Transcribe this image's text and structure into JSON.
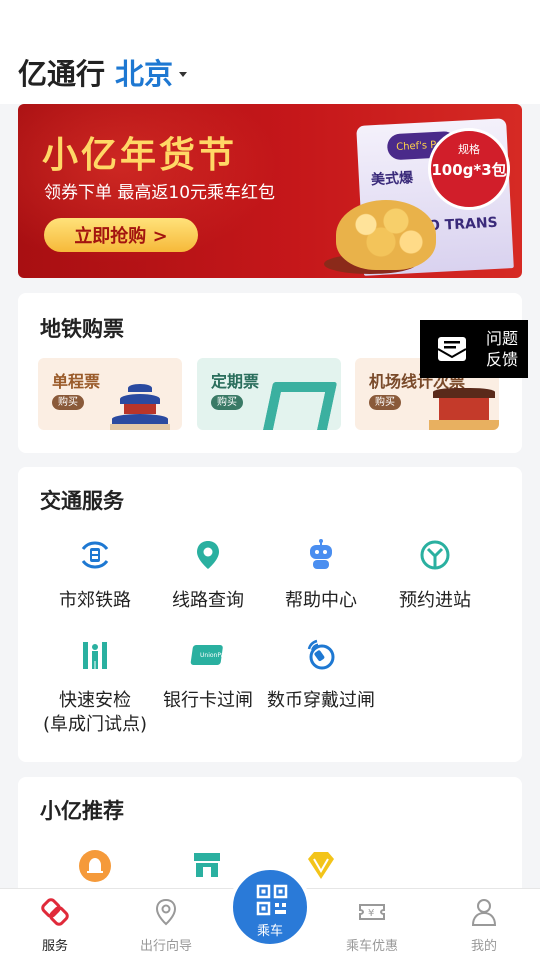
{
  "header": {
    "app_name": "亿通行",
    "city": "北京"
  },
  "banner": {
    "title": "小亿年货节",
    "subtitle": "领券下单 最高返10元乘车红包",
    "button": "立即抢购 >",
    "product_name": "美式爆",
    "badge_spec": "规格",
    "badge_qty": "100g*3包",
    "brand": "Chef's Pop",
    "tag": "ZERO TRANS FAT"
  },
  "metro": {
    "title": "地铁购票",
    "tickets": [
      {
        "label": "单程票",
        "buy": "购买"
      },
      {
        "label": "定期票",
        "buy": "购买"
      },
      {
        "label": "机场线计次票",
        "buy": "购买"
      }
    ]
  },
  "feedback": {
    "label": "问题反馈"
  },
  "transport": {
    "title": "交通服务",
    "items": [
      {
        "label": "市郊铁路",
        "icon": "suburban-rail-icon"
      },
      {
        "label": "线路查询",
        "icon": "location-pin-icon"
      },
      {
        "label": "帮助中心",
        "icon": "robot-icon"
      },
      {
        "label": "预约进站",
        "icon": "reservation-icon"
      },
      {
        "label": "快速安检\n(阜成门试点)",
        "icon": "security-gate-icon"
      },
      {
        "label": "银行卡过闸",
        "icon": "unionpay-icon"
      },
      {
        "label": "数币穿戴过闸",
        "icon": "wearable-icon"
      }
    ]
  },
  "recommend": {
    "title": "小亿推荐",
    "icons": [
      "bell-icon",
      "shop-icon",
      "diamond-icon"
    ]
  },
  "nav": {
    "items": [
      {
        "label": "服务",
        "icon": "service-icon",
        "active": true
      },
      {
        "label": "出行向导",
        "icon": "location-icon",
        "active": false
      },
      {
        "label": "乘车",
        "icon": "qr-code-icon",
        "active": false
      },
      {
        "label": "乘车优惠",
        "icon": "ticket-icon",
        "active": false
      },
      {
        "label": "我的",
        "icon": "person-icon",
        "active": false
      }
    ]
  },
  "colors": {
    "accent": "#1e78d2",
    "brand_red": "#e02a3a",
    "banner_red": "#c5171a",
    "teal": "#2ab0a0"
  }
}
